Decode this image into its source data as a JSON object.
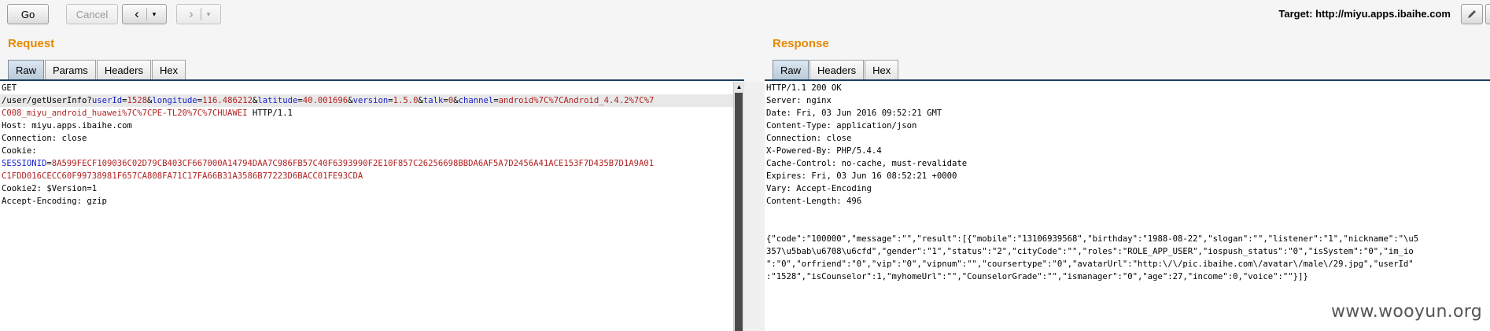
{
  "toolbar": {
    "go_label": "Go",
    "cancel_label": "Cancel",
    "back_icon": "‹",
    "forward_icon": "›",
    "dropdown_icon": "▾",
    "target": "Target: http://miyu.apps.ibaihe.com"
  },
  "request": {
    "title": "Request",
    "tabs": [
      "Raw",
      "Params",
      "Headers",
      "Hex"
    ],
    "active_tab": "Raw",
    "method": "GET",
    "url_path": "/user/getUserInfo?",
    "params": [
      {
        "key": "userId",
        "value": "1528"
      },
      {
        "key": "longitude",
        "value": "116.486212"
      },
      {
        "key": "latitude",
        "value": "40.001696"
      },
      {
        "key": "version",
        "value": "1.5.0"
      },
      {
        "key": "talk",
        "value": "0"
      },
      {
        "key": "channel",
        "value": "android%7C%7CAndroid_4.4.2%7C%7C008_miyu_android_huawei%7C%7CPE-TL20%7C%7CHUAWEI"
      }
    ],
    "channel_line1": "android%7C%7CAndroid_4.4.2%7C%7",
    "channel_line2": "C008_miyu_android_huawei%7C%7CPE-TL20%7C%7CHUAWEI",
    "protocol": " HTTP/1.1",
    "host": "Host: miyu.apps.ibaihe.com",
    "connection": "Connection: close",
    "cookie_label": "Cookie:",
    "session_key": "SESSIONID",
    "session_value_line1": "8A599FECF109036C02D79CB403CF667000A14794DAA7C986FB57C40F6393990F2E10F857C26256698BBDA6AF5A7D2456A41ACE153F7D435B7D1A9A01",
    "session_value_line2": "C1FDD016CECC60F99738981F657CA808FA71C17FA66B31A3586B77223D6BACC01FE93CDA",
    "cookie2": "Cookie2: $Version=1",
    "accept_encoding": "Accept-Encoding: gzip"
  },
  "response": {
    "title": "Response",
    "tabs": [
      "Raw",
      "Headers",
      "Hex"
    ],
    "active_tab": "Raw",
    "header_lines": [
      "HTTP/1.1 200 OK",
      "Server: nginx",
      "Date: Fri, 03 Jun 2016 09:52:21 GMT",
      "Content-Type: application/json",
      "Connection: close",
      "X-Powered-By: PHP/5.4.4",
      "Cache-Control: no-cache, must-revalidate",
      "Expires: Fri, 03 Jun 16 08:52:21 +0000",
      "Vary: Accept-Encoding",
      "Content-Length: 496"
    ],
    "body_lines": [
      "{\"code\":\"100000\",\"message\":\"\",\"result\":[{\"mobile\":\"13106939568\",\"birthday\":\"1988-08-22\",\"slogan\":\"\",\"listener\":\"1\",\"nickname\":\"\\u5",
      "357\\u5bab\\u6708\\u6cfd\",\"gender\":\"1\",\"status\":\"2\",\"cityCode\":\"\",\"roles\":\"ROLE_APP_USER\",\"iospush_status\":\"0\",\"isSystem\":\"0\",\"im_io",
      "\":\"0\",\"orfriend\":\"0\",\"vip\":\"0\",\"vipnum\":\"\",\"coursertype\":\"0\",\"avatarUrl\":\"http:\\/\\/pic.ibaihe.com\\/avatar\\/male\\/29.jpg\",\"userId\"",
      ":\"1528\",\"isCounselor\":1,\"myhomeUrl\":\"\",\"CounselorGrade\":\"\",\"ismanager\":\"0\",\"age\":27,\"income\":0,\"voice\":\"\"}]}"
    ]
  },
  "watermark": "www.wooyun.org"
}
